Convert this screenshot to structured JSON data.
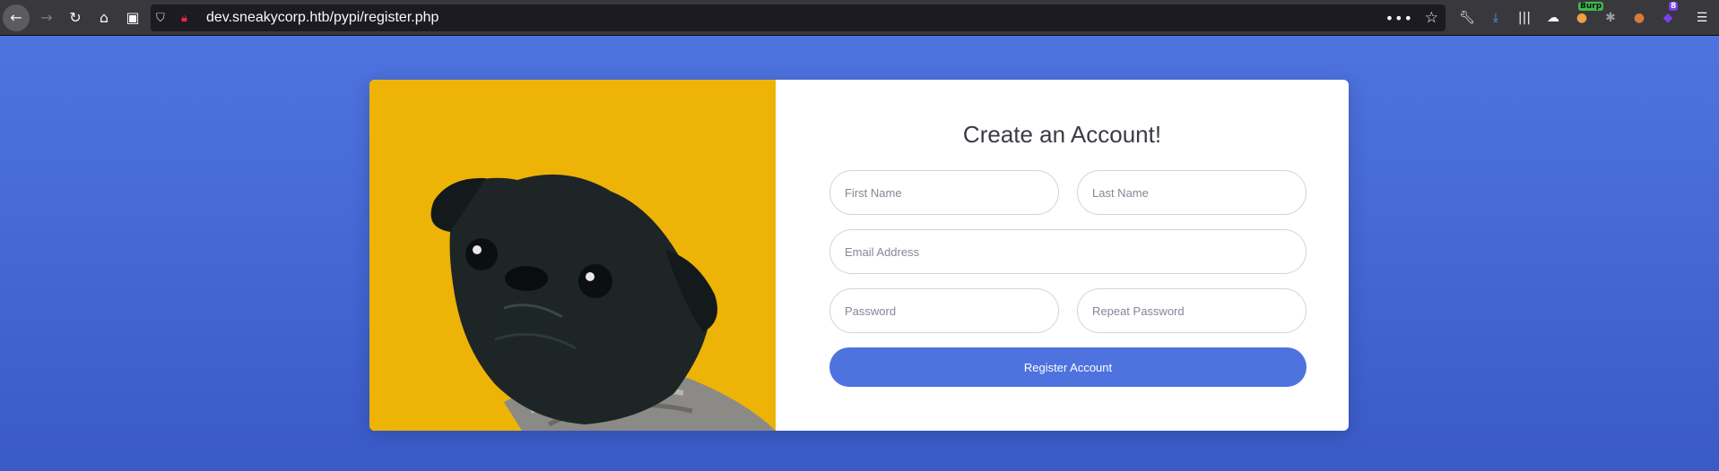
{
  "browser": {
    "url": "dev.sneakycorp.htb/pypi/register.php",
    "nav_icons": [
      "back-icon",
      "forward-icon",
      "reload-icon",
      "home-icon",
      "reader-icon"
    ],
    "burp_badge": "Burp",
    "extension_count": "8"
  },
  "form": {
    "title": "Create an Account!",
    "first_name_placeholder": "First Name",
    "last_name_placeholder": "Last Name",
    "email_placeholder": "Email Address",
    "password_placeholder": "Password",
    "repeat_password_placeholder": "Repeat Password",
    "register_label": "Register Account"
  },
  "colors": {
    "background": "#4e73df",
    "button": "#4e73df",
    "image_panel": "#edb306"
  }
}
